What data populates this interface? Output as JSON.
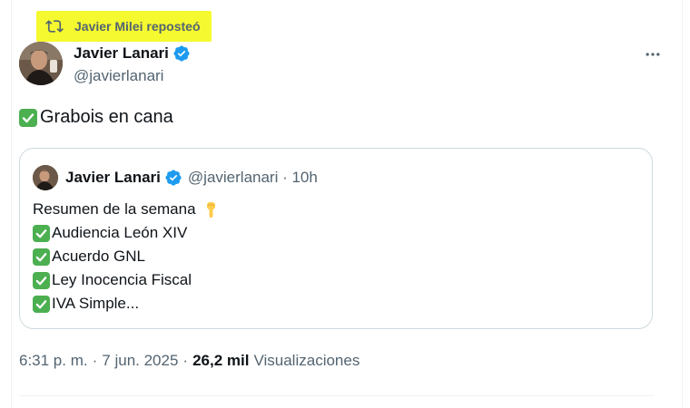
{
  "repost": {
    "text": "Javier Milei reposteó",
    "icon": "repost-icon"
  },
  "author": {
    "name": "Javier Lanari",
    "handle": "@javierlanari",
    "verified": true
  },
  "more_icon": "more-icon",
  "tweet": {
    "check_icon": "check-mark-icon",
    "text": "Grabois en cana"
  },
  "quote": {
    "author_name": "Javier Lanari",
    "author_handle": "@javierlanari · 10h",
    "lines": {
      "0": "Resumen de la semana",
      "1": "Audiencia León XIV",
      "2": "Acuerdo GNL",
      "3": "Ley Inocencia Fiscal",
      "4": "IVA Simple..."
    },
    "pointing_icon": "pointing-down-icon"
  },
  "meta": {
    "time": "6:31 p. m.",
    "date": "7 jun. 2025",
    "separator": "·",
    "views_count": "26,2 mil",
    "views_label": "Visualizaciones"
  },
  "colors": {
    "highlight": "#f5f92f",
    "verified_blue": "#1d9bf0",
    "check_green": "#4caf50",
    "secondary_text": "#536471"
  }
}
